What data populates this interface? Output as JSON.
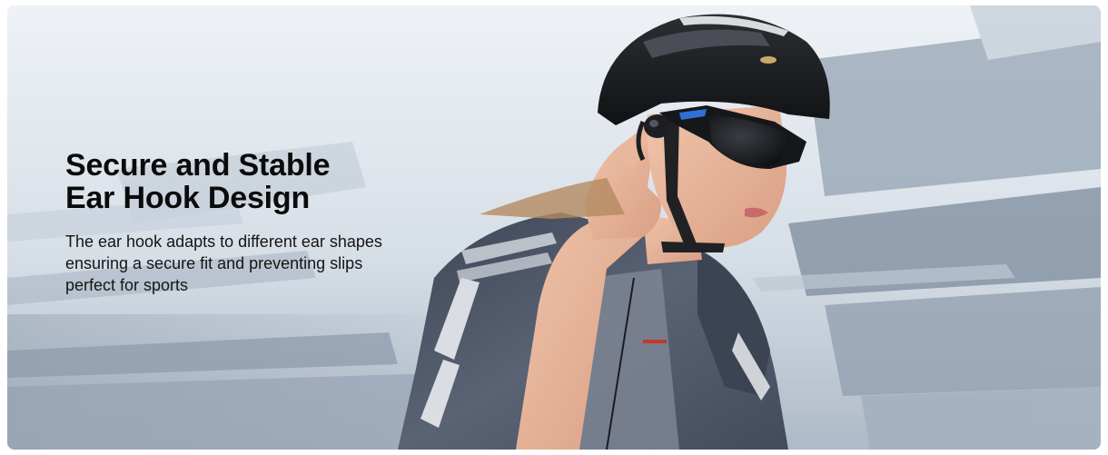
{
  "banner": {
    "headline_line1": "Secure and Stable",
    "headline_line2": "Ear Hook Design",
    "body_line1": "The ear hook adapts to different ear shapes",
    "body_line2": "ensuring a secure fit and preventing slips",
    "body_line3": "perfect for sports"
  },
  "colors": {
    "sky": "#e9eef3",
    "motion_blur": "#9aa8b8",
    "helmet": "#1c1d20",
    "jersey": "#4a5262",
    "skin": "#e8b79c",
    "text": "#0b0b0b"
  },
  "icons": [
    "cyclist-photo",
    "helmet-icon",
    "sunglasses-icon",
    "earbud-icon"
  ]
}
